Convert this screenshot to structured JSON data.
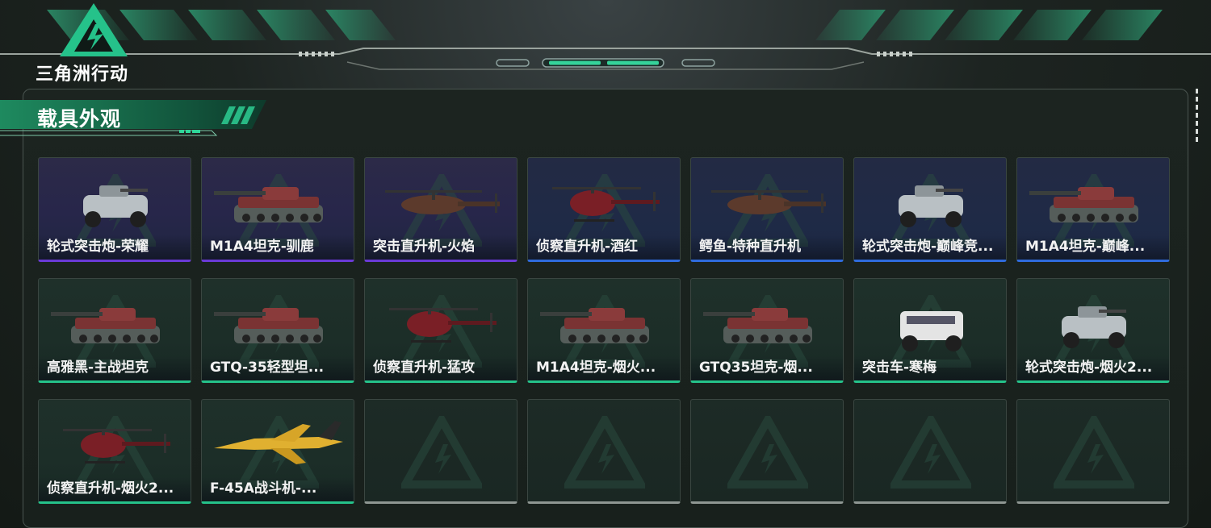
{
  "header": {
    "logo_text": "三角洲行动"
  },
  "section": {
    "title": "载具外观"
  },
  "colors": {
    "accent_green": "#25c28a",
    "rarity_purple": "#6a3ad6",
    "rarity_blue": "#2f6bdc",
    "empty_slot": "#8e9692"
  },
  "skins": [
    {
      "name": "轮式突击炮-荣耀",
      "rarity": "purple",
      "icon": "armored-car-icon"
    },
    {
      "name": "M1A4坦克-驯鹿",
      "rarity": "purple",
      "icon": "tank-icon"
    },
    {
      "name": "突击直升机-火焰",
      "rarity": "purple",
      "icon": "attack-helicopter-icon"
    },
    {
      "name": "侦察直升机-酒红",
      "rarity": "blue",
      "icon": "scout-helicopter-icon"
    },
    {
      "name": "鳄鱼-特种直升机",
      "rarity": "blue",
      "icon": "attack-helicopter-icon"
    },
    {
      "name": "轮式突击炮-巅峰竞...",
      "rarity": "blue",
      "icon": "armored-car-icon"
    },
    {
      "name": "M1A4坦克-巅峰...",
      "rarity": "blue",
      "icon": "tank-icon"
    },
    {
      "name": "高雅黑-主战坦克",
      "rarity": "green",
      "icon": "tank-icon"
    },
    {
      "name": "GTQ-35轻型坦...",
      "rarity": "green",
      "icon": "tank-icon"
    },
    {
      "name": "侦察直升机-猛攻",
      "rarity": "green",
      "icon": "scout-helicopter-icon"
    },
    {
      "name": "M1A4坦克-烟火...",
      "rarity": "green",
      "icon": "tank-icon"
    },
    {
      "name": "GTQ35坦克-烟...",
      "rarity": "green",
      "icon": "tank-icon"
    },
    {
      "name": "突击车-寒梅",
      "rarity": "green",
      "icon": "assault-vehicle-icon"
    },
    {
      "name": "轮式突击炮-烟火2...",
      "rarity": "green",
      "icon": "armored-car-icon"
    },
    {
      "name": "侦察直升机-烟火2...",
      "rarity": "green",
      "icon": "scout-helicopter-icon"
    },
    {
      "name": "F-45A战斗机-...",
      "rarity": "green",
      "icon": "fighter-jet-icon"
    }
  ],
  "empty_slots": 5
}
